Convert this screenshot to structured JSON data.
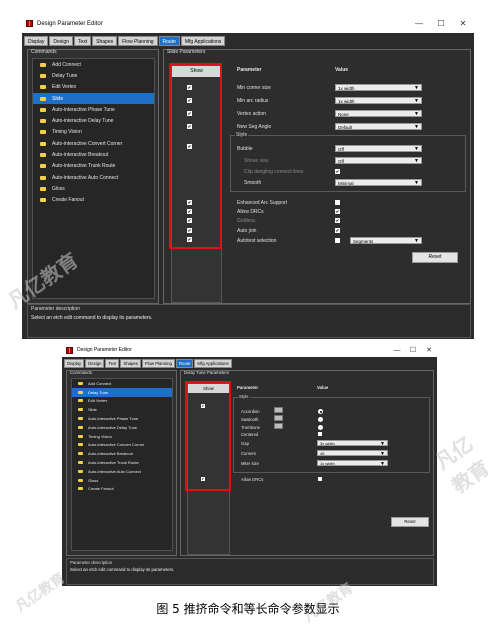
{
  "window1": {
    "title": "Design Parameter Editor",
    "controls": [
      "—",
      "☐",
      "✕"
    ],
    "tabs": [
      "Display",
      "Design",
      "Text",
      "Shapes",
      "Flow Planning",
      "Route",
      "Mfg Applications"
    ],
    "active_tab": "Route",
    "commands_label": "Commands",
    "commands": [
      "Add Connect",
      "Delay Tune",
      "Edit Vertex",
      "Slide",
      "Auto-interactive Phase Tune",
      "Auto-interactive Delay Tune",
      "Timing Vision",
      "Auto-interactive Convert Corner",
      "Auto-interactive Breakout",
      "Auto-interactive Trunk Route",
      "Auto-interactive Auto Connect",
      "Gloss",
      "Create Fanout"
    ],
    "selected_command": "Slide",
    "params_label": "Slide Parameters",
    "show_header": "Show",
    "parameter_header": "Parameter",
    "value_header": "Value",
    "params": [
      {
        "label": "Min corner size",
        "value": "1x width"
      },
      {
        "label": "Min arc radius",
        "value": "1x width"
      },
      {
        "label": "Vertex action",
        "value": "None"
      },
      {
        "label": "New Seg Angle",
        "value": "Default"
      }
    ],
    "style_label": "Style",
    "style_params": [
      {
        "label": "Bubble",
        "value": "Off"
      },
      {
        "label": "Shove vias",
        "value": "Off"
      },
      {
        "label": "Clip dangling connect lines",
        "value": ""
      },
      {
        "label": "Smooth",
        "value": "Minimal"
      }
    ],
    "bottom_params": [
      "Enhanced Arc Support",
      "Allow DRCs",
      "Gridless",
      "Auto join",
      "Autotest selection"
    ],
    "segments_value": "Segments",
    "reset_label": "Reset",
    "desc_label": "Parameter description",
    "desc_text": "Select an etch edit command to display its parameters."
  },
  "window2": {
    "title": "Design Parameter Editor",
    "controls": [
      "—",
      "☐",
      "✕"
    ],
    "tabs": [
      "Display",
      "Design",
      "Text",
      "Shapes",
      "Flow Planning",
      "Route",
      "Mfg Applications"
    ],
    "active_tab": "Route",
    "commands_label": "Commands",
    "commands": [
      "Add Connect",
      "Delay Tune",
      "Edit Vertex",
      "Slide",
      "Auto-interactive Phase Tune",
      "Auto-interactive Delay Tune",
      "Timing Vision",
      "Auto-interactive Convert Corner",
      "Auto-interactive Breakout",
      "Auto-interactive Trunk Route",
      "Auto-interactive Auto Connect",
      "Gloss",
      "Create Fanout"
    ],
    "selected_command": "Delay Tune",
    "params_label": "Delay Tune Parameters",
    "show_header": "Show",
    "parameter_header": "Parameter",
    "value_header": "Value",
    "style_label": "Style",
    "style_options": [
      "Accordion",
      "Sawtooth",
      "Trombone",
      "Centered"
    ],
    "params": [
      {
        "label": "Gap",
        "value": "3x width"
      },
      {
        "label": "Corners",
        "value": "45"
      },
      {
        "label": "Miter size",
        "value": "1x width"
      }
    ],
    "allow_drcs": "Allow DRCs",
    "reset_label": "Reset",
    "desc_label": "Parameter description",
    "desc_text": "Select an etch edit command to display its parameters."
  },
  "caption": "图 5 推挤命令和等长命令参数显示",
  "watermarks": [
    {
      "text": "凡亿教育",
      "sub": "www.FANYEDU.COM"
    }
  ]
}
